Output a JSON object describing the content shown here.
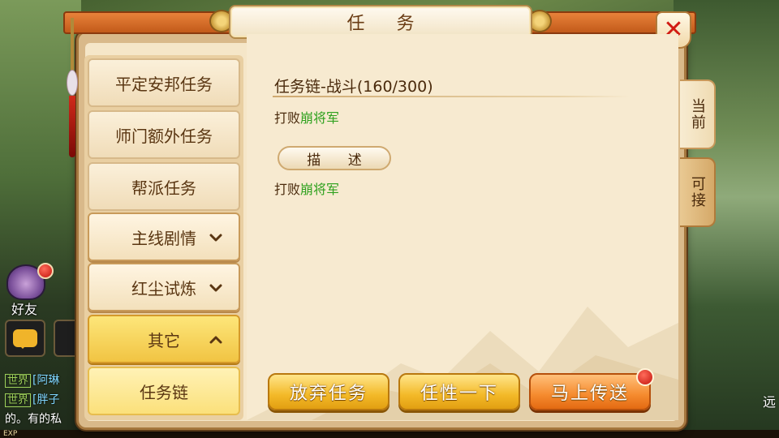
{
  "dialog": {
    "title": "任 务",
    "close_symbol": "✕"
  },
  "tabs": {
    "current": "当前",
    "available": "可接"
  },
  "left_list": {
    "items": [
      {
        "label": "平定安邦任务"
      },
      {
        "label": "师门额外任务"
      },
      {
        "label": "帮派任务"
      }
    ],
    "groups": [
      {
        "label": "主线剧情",
        "state": "collapsed"
      },
      {
        "label": "红尘试炼",
        "state": "collapsed"
      },
      {
        "label": "其它",
        "state": "expanded"
      }
    ],
    "selected_sub": "任务链"
  },
  "task": {
    "title": "任务链-战斗(160/300)",
    "objective_prefix": "打败",
    "objective_target": "崩将军",
    "desc_label": "描 述",
    "desc_prefix": "打败",
    "desc_target": "崩将军"
  },
  "buttons": {
    "abandon": "放弃任务",
    "random": "任性一下",
    "teleport": "马上传送"
  },
  "hud": {
    "friend_label": "好友",
    "chat_tag": "世界",
    "chat_line1_name": "[阿琳",
    "chat_line2_name": "[胖子",
    "chat_line3": "的。有的私",
    "exp_label": "EXP",
    "right_text": "远"
  },
  "colors": {
    "accent_orange": "#e8823a",
    "highlight_green": "#2fa11e",
    "close_red": "#d11a12",
    "text_brown": "#4a2a0c"
  }
}
